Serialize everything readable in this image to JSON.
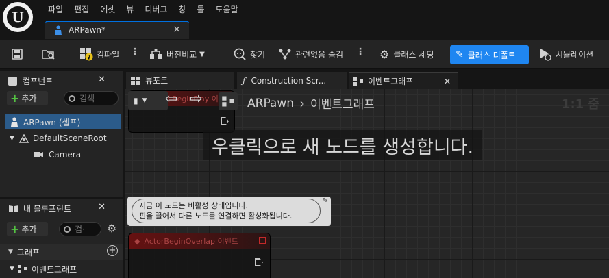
{
  "menu": [
    "파일",
    "편집",
    "에셋",
    "뷰",
    "디버그",
    "창",
    "툴",
    "도움말"
  ],
  "document_tab": {
    "label": "ARPawn*",
    "close": "×"
  },
  "toolbar": {
    "compile": "컴파일",
    "diff": "버전비교",
    "find": "찾기",
    "hide_unrelated": "관련없음 숨김",
    "class_settings": "클래스 세팅",
    "class_defaults": "클래스 디폴트",
    "simulation": "시뮬레이션"
  },
  "components_panel": {
    "title": "컴포넌트",
    "add": "추가",
    "search_placeholder": "검색",
    "tree": [
      {
        "label": "ARPawn (셀프)",
        "selected": true
      },
      {
        "label": "DefaultSceneRoot"
      },
      {
        "label": "Camera"
      }
    ]
  },
  "my_blueprint_panel": {
    "title": "내 블루프린트",
    "add": "추가",
    "search_placeholder": "검·",
    "section_graph": "그래프",
    "event_graph_item": "이벤트그래프"
  },
  "graph_tabs": {
    "viewport": "뷰포트",
    "construction": "Construction Scr...",
    "event_graph": "이벤트그래프"
  },
  "graph": {
    "breadcrumb_root": "ARPawn",
    "breadcrumb_sep": "›",
    "breadcrumb_current": "이벤트그래프",
    "zoom": "1:1 줌",
    "hint": "우클릭으로 새 노드를 생성합니다.",
    "tooltip_line1": "지금 이 노드는 비활성 상태입니다.",
    "tooltip_line2": "핀을 끌어서 다른 노드를 연결하면 활성화됩니다.",
    "node_top_title": "Event BeginPlay 이벤트",
    "node_overlap_title": "ActorBeginOverlap 이벤트"
  },
  "colors": {
    "accent": "#1f86f1",
    "selection": "#2b5b8a",
    "node_header": "#6a1010",
    "add_plus": "#54c242"
  }
}
